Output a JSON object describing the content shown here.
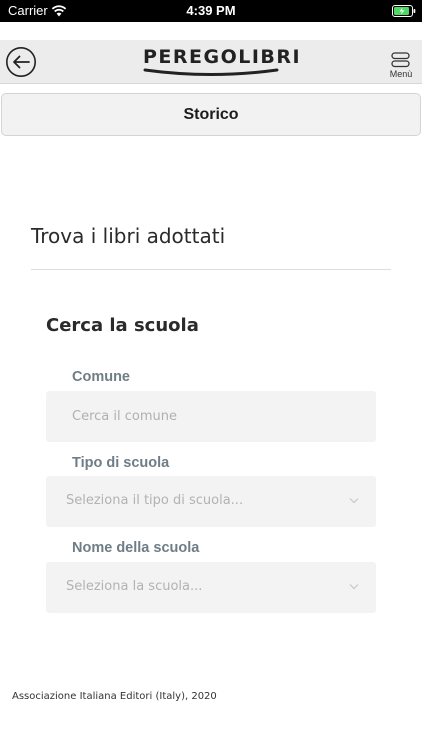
{
  "status_bar": {
    "carrier": "Carrier",
    "time": "4:39 PM"
  },
  "header": {
    "logo_text": "PEREGOLIBRI",
    "menu_label": "Menù"
  },
  "history_button": {
    "label": "Storico"
  },
  "main": {
    "title": "Trova i libri adottati",
    "section_title": "Cerca la scuola",
    "fields": [
      {
        "label": "Comune",
        "placeholder": "Cerca il comune"
      },
      {
        "label": "Tipo di scuola",
        "placeholder": "Seleziona il tipo di scuola..."
      },
      {
        "label": "Nome della scuola",
        "placeholder": "Seleziona la scuola..."
      }
    ]
  },
  "footer": {
    "text": "Associazione Italiana Editori (Italy), 2020"
  },
  "colors": {
    "label": "#6f7d86",
    "field_bg": "#f3f3f3",
    "navbar_bg": "#ececec",
    "battery_charge": "#4cd964"
  },
  "icons": [
    "wifi-icon",
    "battery-icon",
    "back-arrow-icon",
    "menu-icon",
    "chevron-down-icon"
  ]
}
